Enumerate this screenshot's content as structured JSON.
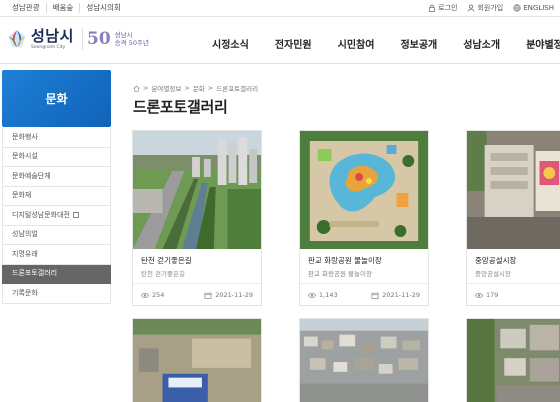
{
  "util": {
    "left_links": [
      "성남관광",
      "배움숲",
      "성남시의회"
    ],
    "login": "로그인",
    "signup": "회원가입",
    "english": "ENGLISH"
  },
  "header": {
    "city_name": "성남시",
    "city_en": "Seongnam City",
    "anniv_number": "50",
    "anniv_line1": "성남시",
    "anniv_line2": "승격 50주년",
    "nav": [
      "시정소식",
      "전자민원",
      "시민참여",
      "정보공개",
      "성남소개",
      "분야별정보"
    ]
  },
  "sidebar": {
    "title": "문화",
    "items": [
      "문화행사",
      "문화시설",
      "문화예술단체",
      "문화재",
      "디지털성남문화대전",
      "성남의얼",
      "지명유래",
      "드론포토갤러리",
      "기록문화"
    ],
    "active_index": 7
  },
  "breadcrumb": [
    "분야별정보",
    "문화",
    "드론포토갤러리"
  ],
  "page_title": "드론포토갤러리",
  "cards": [
    {
      "title": "탄천 걷기좋은길",
      "subtitle": "탄천 걷기좋은길",
      "views": "254",
      "date": "2021-11-29"
    },
    {
      "title": "판교 화랑공원 물놀이장",
      "subtitle": "판교 화랑공원 물놀이장",
      "views": "1,143",
      "date": "2021-11-29"
    },
    {
      "title": "중앙공설시장",
      "subtitle": "중앙공설시장",
      "views": "179",
      "date": ""
    }
  ],
  "colors": {
    "brand_blue": "#1a73cf",
    "active_gray": "#666666",
    "anniv_purple": "#8a7fc0"
  }
}
